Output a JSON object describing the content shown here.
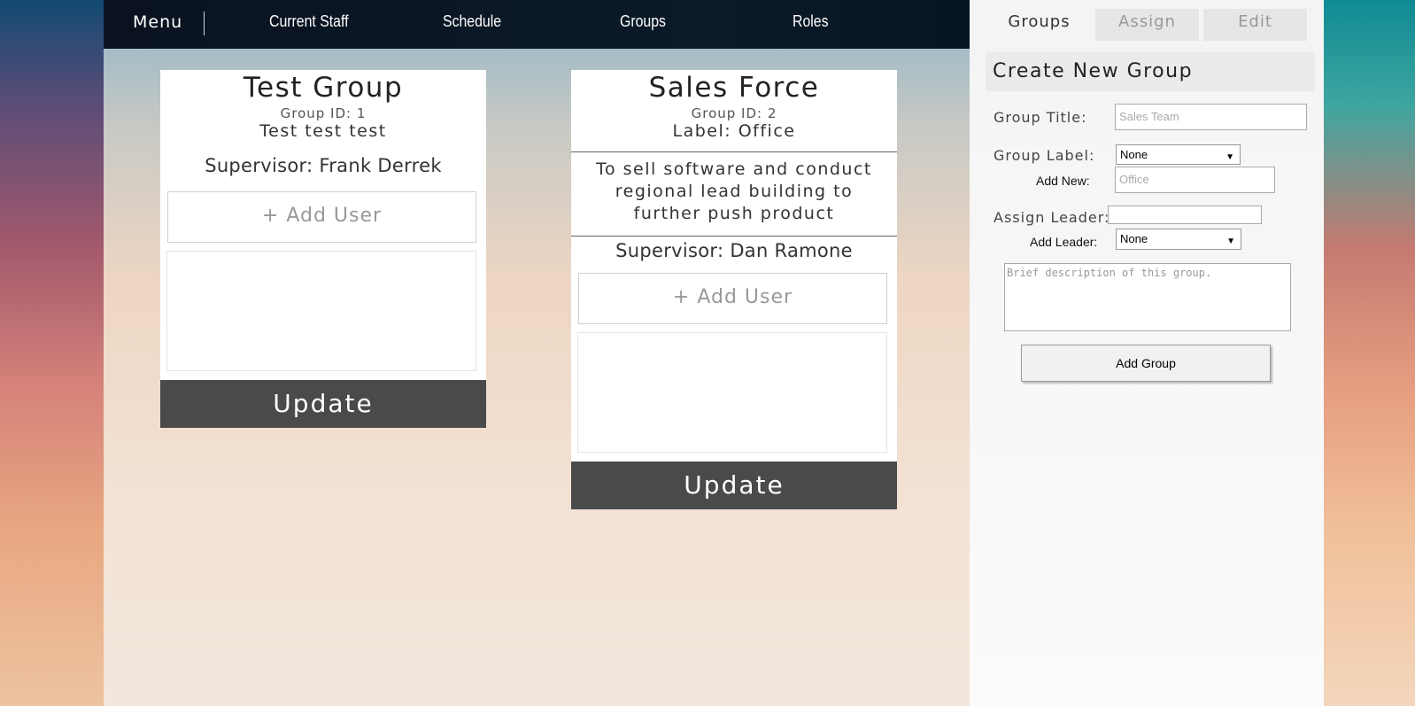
{
  "nav": {
    "menu": "Menu",
    "links": [
      "Current Staff",
      "Schedule",
      "Groups",
      "Roles"
    ]
  },
  "groups": [
    {
      "title": "Test Group",
      "id": "Group ID: 1",
      "desc": "Test test test",
      "supervisor": "Supervisor: Frank Derrek",
      "add_user": "+ Add User",
      "update": "Update"
    },
    {
      "title": "Sales Force",
      "id": "Group ID: 2",
      "label": "Label: Office",
      "desc": "To sell software and conduct regional lead building to further push product",
      "supervisor": "Supervisor: Dan Ramone",
      "add_user": "+ Add User",
      "update": "Update"
    }
  ],
  "panel": {
    "tabs": [
      "Groups",
      "Assign",
      "Edit"
    ],
    "active_tab": "Groups",
    "heading": "Create New Group",
    "group_title_label": "Group Title:",
    "group_title_placeholder": "Sales Team",
    "group_label_label": "Group Label:",
    "group_label_value": "None",
    "add_new_label": "Add New:",
    "add_new_placeholder": "Office",
    "assign_leader_label": "Assign Leader:",
    "assign_leader_value": "",
    "add_leader_label": "Add Leader:",
    "add_leader_value": "None",
    "description_placeholder": "Brief description of this group.",
    "submit": "Add Group"
  }
}
